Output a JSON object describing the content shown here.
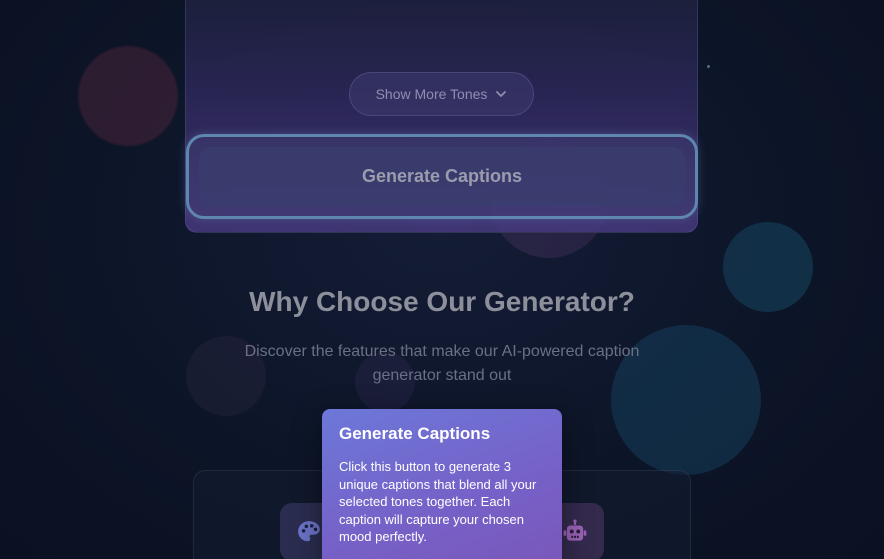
{
  "tones": {
    "show_more_label": "Show More Tones",
    "chevron_icon": "chevron-down-icon"
  },
  "generate": {
    "button_label": "Generate Captions"
  },
  "features": {
    "title": "Why Choose Our Generator?",
    "subtitle": "Discover the features that make our AI-powered caption generator stand out",
    "icons": [
      "palette-icon",
      "robot-icon"
    ]
  },
  "tooltip": {
    "title": "Generate Captions",
    "body": "Click this button to generate 3 unique captions that blend all your selected tones together. Each caption will capture your chosen mood perfectly."
  },
  "colors": {
    "background": "#0c1427",
    "tooltip_start": "#6c78d8",
    "tooltip_end": "#7a56b8",
    "generate_border": "#5f86ae"
  }
}
